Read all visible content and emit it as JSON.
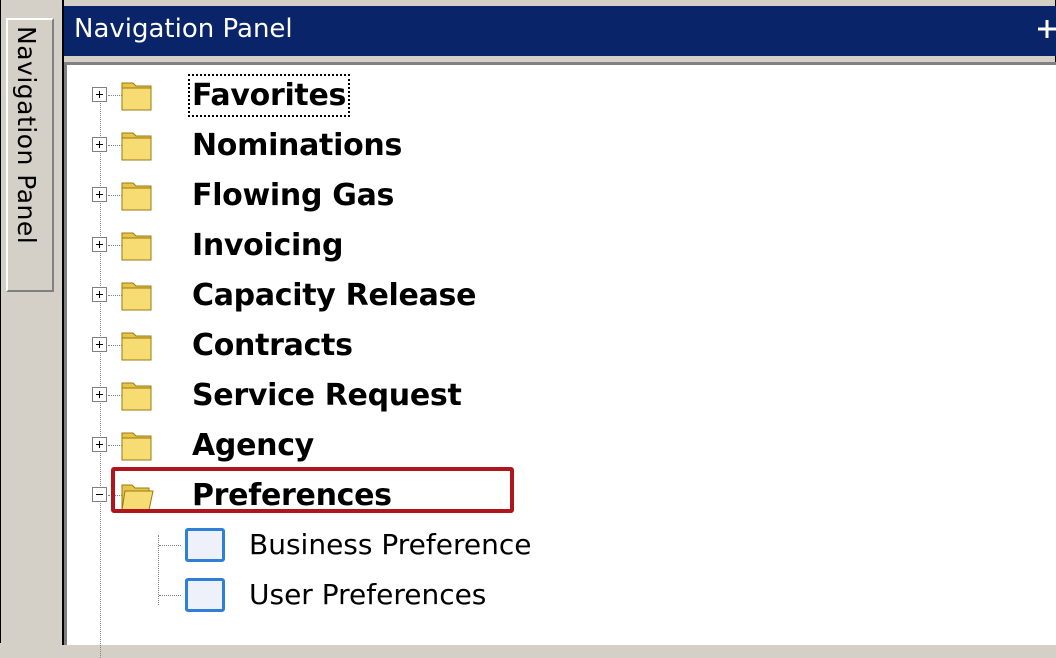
{
  "side_tab": {
    "label": "Navigation Panel"
  },
  "panel": {
    "title": "Navigation Panel",
    "pin_icon": "pin-icon"
  },
  "tree": {
    "items": [
      {
        "label": "Favorites",
        "expanded": false,
        "icon": "folder-icon",
        "focused": true
      },
      {
        "label": "Nominations",
        "expanded": false,
        "icon": "folder-icon"
      },
      {
        "label": "Flowing Gas",
        "expanded": false,
        "icon": "folder-icon"
      },
      {
        "label": "Invoicing",
        "expanded": false,
        "icon": "folder-icon"
      },
      {
        "label": "Capacity Release",
        "expanded": false,
        "icon": "folder-icon"
      },
      {
        "label": "Contracts",
        "expanded": false,
        "icon": "folder-icon"
      },
      {
        "label": "Service Request",
        "expanded": false,
        "icon": "folder-icon"
      },
      {
        "label": "Agency",
        "expanded": false,
        "icon": "folder-icon"
      },
      {
        "label": "Preferences",
        "expanded": true,
        "icon": "open-folder-icon",
        "children": [
          {
            "label": "Business Preference",
            "icon": "document-icon",
            "highlighted": true
          },
          {
            "label": "User Preferences",
            "icon": "document-icon"
          }
        ]
      }
    ]
  },
  "colors": {
    "title_bar": "#0a246a",
    "highlight": "#b0141c",
    "doc_border": "#2f7fd8",
    "folder": "#f2d25a"
  }
}
